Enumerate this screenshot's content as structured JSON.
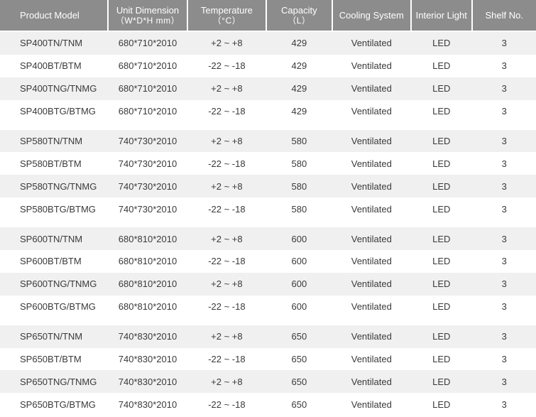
{
  "headers": {
    "model": "Product Model",
    "dimension": "Unit Dimension",
    "dimension_unit": "（W*D*H mm）",
    "temperature": "Temperature",
    "temperature_unit": "（°C）",
    "capacity": "Capacity",
    "capacity_unit": "（L）",
    "cooling": "Cooling System",
    "light": "Interior Light",
    "shelf": "Shelf No."
  },
  "groups": [
    {
      "rows": [
        {
          "model": "SP400TN/TNM",
          "dimension": "680*710*2010",
          "temperature": "+2 ~ +8",
          "capacity": "429",
          "cooling": "Ventilated",
          "light": "LED",
          "shelf": "3"
        },
        {
          "model": "SP400BT/BTM",
          "dimension": "680*710*2010",
          "temperature": "-22 ~ -18",
          "capacity": "429",
          "cooling": "Ventilated",
          "light": "LED",
          "shelf": "3"
        },
        {
          "model": "SP400TNG/TNMG",
          "dimension": "680*710*2010",
          "temperature": "+2 ~ +8",
          "capacity": "429",
          "cooling": "Ventilated",
          "light": "LED",
          "shelf": "3"
        },
        {
          "model": "SP400BTG/BTMG",
          "dimension": "680*710*2010",
          "temperature": "-22 ~ -18",
          "capacity": "429",
          "cooling": "Ventilated",
          "light": "LED",
          "shelf": "3"
        }
      ]
    },
    {
      "rows": [
        {
          "model": "SP580TN/TNM",
          "dimension": "740*730*2010",
          "temperature": "+2 ~ +8",
          "capacity": "580",
          "cooling": "Ventilated",
          "light": "LED",
          "shelf": "3"
        },
        {
          "model": "SP580BT/BTM",
          "dimension": "740*730*2010",
          "temperature": "-22 ~ -18",
          "capacity": "580",
          "cooling": "Ventilated",
          "light": "LED",
          "shelf": "3"
        },
        {
          "model": "SP580TNG/TNMG",
          "dimension": "740*730*2010",
          "temperature": "+2 ~ +8",
          "capacity": "580",
          "cooling": "Ventilated",
          "light": "LED",
          "shelf": "3"
        },
        {
          "model": "SP580BTG/BTMG",
          "dimension": "740*730*2010",
          "temperature": "-22 ~ -18",
          "capacity": "580",
          "cooling": "Ventilated",
          "light": "LED",
          "shelf": "3"
        }
      ]
    },
    {
      "rows": [
        {
          "model": "SP600TN/TNM",
          "dimension": "680*810*2010",
          "temperature": "+2 ~ +8",
          "capacity": "600",
          "cooling": "Ventilated",
          "light": "LED",
          "shelf": "3"
        },
        {
          "model": "SP600BT/BTM",
          "dimension": "680*810*2010",
          "temperature": "-22 ~ -18",
          "capacity": "600",
          "cooling": "Ventilated",
          "light": "LED",
          "shelf": "3"
        },
        {
          "model": "SP600TNG/TNMG",
          "dimension": "680*810*2010",
          "temperature": "+2 ~ +8",
          "capacity": "600",
          "cooling": "Ventilated",
          "light": "LED",
          "shelf": "3"
        },
        {
          "model": "SP600BTG/BTMG",
          "dimension": "680*810*2010",
          "temperature": "-22 ~ -18",
          "capacity": "600",
          "cooling": "Ventilated",
          "light": "LED",
          "shelf": "3"
        }
      ]
    },
    {
      "rows": [
        {
          "model": "SP650TN/TNM",
          "dimension": "740*830*2010",
          "temperature": "+2 ~ +8",
          "capacity": "650",
          "cooling": "Ventilated",
          "light": "LED",
          "shelf": "3"
        },
        {
          "model": "SP650BT/BTM",
          "dimension": "740*830*2010",
          "temperature": "-22 ~ -18",
          "capacity": "650",
          "cooling": "Ventilated",
          "light": "LED",
          "shelf": "3"
        },
        {
          "model": "SP650TNG/TNMG",
          "dimension": "740*830*2010",
          "temperature": "+2 ~ +8",
          "capacity": "650",
          "cooling": "Ventilated",
          "light": "LED",
          "shelf": "3"
        },
        {
          "model": "SP650BTG/BTMG",
          "dimension": "740*830*2010",
          "temperature": "-22 ~ -18",
          "capacity": "650",
          "cooling": "Ventilated",
          "light": "LED",
          "shelf": "3"
        }
      ]
    }
  ]
}
